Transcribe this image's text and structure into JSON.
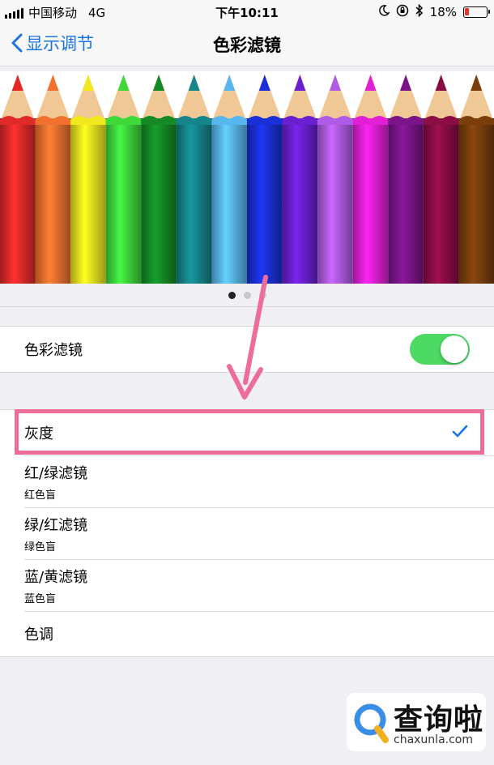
{
  "status_bar": {
    "carrier": "中国移动",
    "network": "4G",
    "time": "下午10:11",
    "battery_percent": "18%",
    "battery_level": 0.18,
    "battery_color": "#e5362a"
  },
  "nav": {
    "back_label": "显示调节",
    "title": "色彩滤镜"
  },
  "preview": {
    "pencil_colors": [
      "#e02a2a",
      "#f2702e",
      "#f2e81e",
      "#3ed83a",
      "#138a25",
      "#14858a",
      "#58b6ee",
      "#1a2fd6",
      "#6a1fd0",
      "#b05ae8",
      "#e31fd6",
      "#7a1488",
      "#8a0d44",
      "#7a3e0c"
    ],
    "page_count": 3,
    "active_page": 0
  },
  "toggle_row": {
    "label": "色彩滤镜",
    "on": true,
    "on_color": "#4cd964"
  },
  "filters": [
    {
      "label": "灰度",
      "subtitle": "",
      "selected": true
    },
    {
      "label": "红/绿滤镜",
      "subtitle": "红色盲",
      "selected": false
    },
    {
      "label": "绿/红滤镜",
      "subtitle": "绿色盲",
      "selected": false
    },
    {
      "label": "蓝/黄滤镜",
      "subtitle": "蓝色盲",
      "selected": false
    },
    {
      "label": "色调",
      "subtitle": "",
      "selected": false
    }
  ],
  "annotation": {
    "highlight_color": "#ee6c9a"
  },
  "watermark": {
    "brand": "查询啦",
    "url": "chaxunla.com"
  },
  "colors": {
    "accent": "#1a74e0",
    "background": "#efeff4"
  }
}
